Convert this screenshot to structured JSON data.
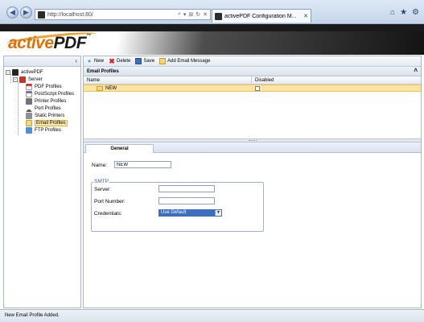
{
  "browser": {
    "address_url": "http://localhost:80/",
    "tab_title": "activePDF Configuration M...",
    "addr_icons": [
      "⌕",
      "▾",
      "⊞",
      "↻",
      "✕"
    ],
    "tools": [
      "⌂",
      "★",
      "⚙"
    ]
  },
  "app": {
    "logo_active": "active",
    "logo_pdf": "PDF",
    "logo_tm": "™"
  },
  "tree": {
    "root": "activePDF",
    "server": "Server",
    "items": [
      {
        "label": "PDF Profiles",
        "icon": "pdf-icon"
      },
      {
        "label": "PostScript Profiles",
        "icon": "postscript-icon"
      },
      {
        "label": "Printer Profiles",
        "icon": "printer-icon"
      },
      {
        "label": "Port Profiles",
        "icon": "port-icon"
      },
      {
        "label": "Static Printers",
        "icon": "static-printer-icon"
      },
      {
        "label": "Email Profiles",
        "icon": "email-icon"
      },
      {
        "label": "FTP Profiles",
        "icon": "ftp-icon"
      }
    ],
    "selected": "Email Profiles"
  },
  "toolbar": {
    "new_label": "New",
    "delete_label": "Delete",
    "save_label": "Save",
    "add_email_label": "Add Email Message"
  },
  "profiles": {
    "section_title": "Email Profiles",
    "columns": [
      "Name",
      "Disabled"
    ],
    "rows": [
      {
        "name": "NEW",
        "disabled": false
      }
    ]
  },
  "detail": {
    "tab_label": "General",
    "name_label": "Name:",
    "name_value": "NEW",
    "smtp_legend": "SMTP",
    "server_label": "Server:",
    "server_value": "",
    "port_label": "Port Number:",
    "port_value": "",
    "credentials_label": "Credentials:",
    "credentials_value": "Use Default"
  },
  "status": {
    "message": "New Email Profile Added."
  },
  "colors": {
    "selection": "#fbe3a0",
    "brand_orange": "#d9730f",
    "select_blue": "#3b6fc0"
  }
}
